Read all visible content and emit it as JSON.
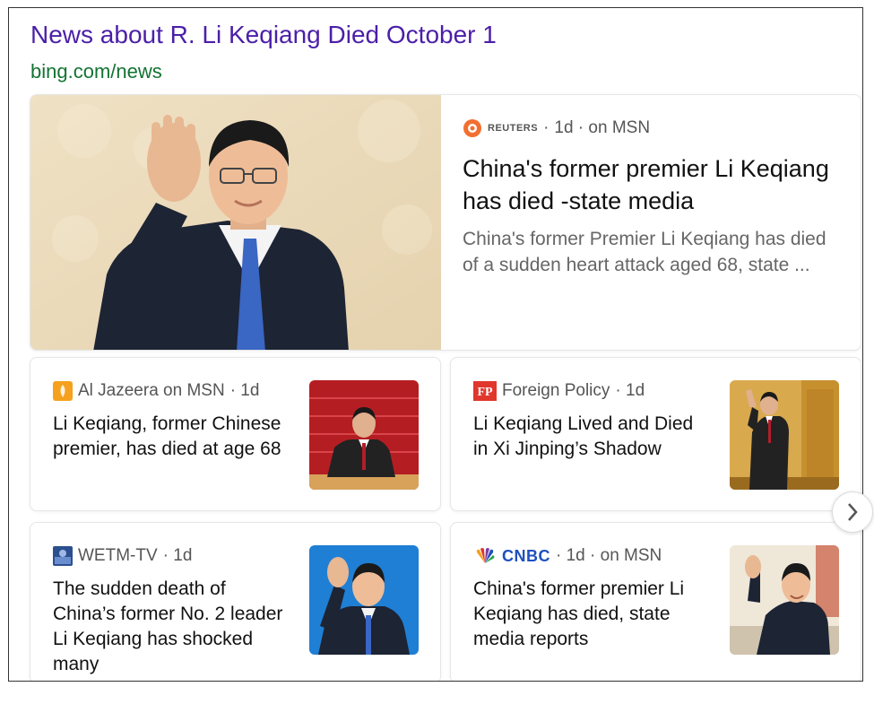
{
  "header": {
    "title": "News about R. Li Keqiang Died October 1",
    "url": "bing.com/news"
  },
  "top_story": {
    "source_logo_text": "REUTERS",
    "separator": "·",
    "age": "1d · on MSN",
    "headline": "China's former premier Li Keqiang has died -state media",
    "snippet": "China's former Premier Li Keqiang has died of a sudden heart attack aged 68, state ..."
  },
  "cards": [
    {
      "source": "Al Jazeera on MSN",
      "age": "· 1d",
      "headline": "Li Keqiang, former Chinese premier, has died at age 68"
    },
    {
      "source_logo_text": "FP",
      "source": "Foreign Policy",
      "age": "· 1d",
      "headline": "Li Keqiang Lived and Died in Xi Jinping’s Shadow"
    },
    {
      "source": "WETM-TV",
      "age": "· 1d",
      "headline": "The sudden death of China’s former No. 2 leader Li Keqiang has shocked many"
    },
    {
      "source_logo_text": "CNBC",
      "age": "· 1d · on MSN",
      "headline": "China's former premier Li Keqiang has died, state media reports"
    }
  ],
  "colors": {
    "title": "#4b1fa8",
    "url": "#137333",
    "reuters": "#f26f31",
    "aljazeera": "#f5a11d",
    "fp": "#e0362c",
    "cnbc": "#1f4fbf"
  },
  "icons": [
    "reuters-logo",
    "aljazeera-logo",
    "foreign-policy-logo",
    "wetm-logo",
    "cnbc-peacock-logo",
    "chevron-right-icon"
  ]
}
